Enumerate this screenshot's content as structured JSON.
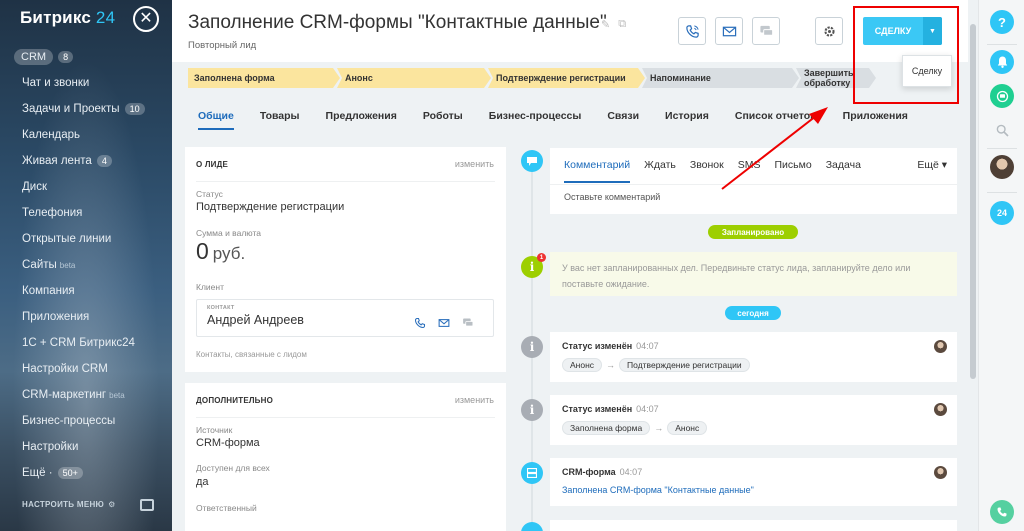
{
  "sidebar": {
    "logo_brand": "Битрикс",
    "logo_num": "24",
    "items": [
      {
        "label": "CRM",
        "badge": "8"
      },
      {
        "label": "Чат и звонки",
        "badge": ""
      },
      {
        "label": "Задачи и Проекты",
        "badge": "10"
      },
      {
        "label": "Календарь",
        "badge": ""
      },
      {
        "label": "Живая лента",
        "badge": "4"
      },
      {
        "label": "Диск",
        "badge": ""
      },
      {
        "label": "Телефония",
        "badge": ""
      },
      {
        "label": "Открытые линии",
        "badge": ""
      },
      {
        "label": "Сайты",
        "sup": "beta"
      },
      {
        "label": "Компания",
        "badge": ""
      },
      {
        "label": "Приложения",
        "badge": ""
      },
      {
        "label": "1С + CRM Битрикс24",
        "badge": ""
      },
      {
        "label": "Настройки CRM",
        "badge": ""
      },
      {
        "label": "CRM-маркетинг",
        "sup": "beta"
      },
      {
        "label": "Бизнес-процессы",
        "badge": ""
      },
      {
        "label": "Настройки",
        "badge": ""
      },
      {
        "label": "Ещё ·",
        "badge": "50+"
      }
    ],
    "footer": "НАСТРОИТЬ МЕНЮ"
  },
  "header": {
    "title": "Заполнение CRM-формы \"Контактные данные\"",
    "subtitle": "Повторный лид",
    "deal_button": "СДЕЛКУ",
    "deal_tooltip": "Сделку"
  },
  "stages": [
    {
      "label": "Заполнена форма",
      "state": "done"
    },
    {
      "label": "Анонс",
      "state": "done"
    },
    {
      "label": "Подтверждение регистрации",
      "state": "done"
    },
    {
      "label": "Напоминание",
      "state": "todo"
    },
    {
      "label": "Завершить обработку",
      "state": "todo"
    }
  ],
  "tabs": [
    "Общие",
    "Товары",
    "Предложения",
    "Роботы",
    "Бизнес-процессы",
    "Связи",
    "История",
    "Список отчетов",
    "Приложения"
  ],
  "about": {
    "header": "О ЛИДЕ",
    "edit": "изменить",
    "status_label": "Статус",
    "status_value": "Подтверждение регистрации",
    "amount_label": "Сумма и валюта",
    "amount_value": "0",
    "currency": "руб.",
    "client_label": "Клиент",
    "contact_kind": "КОНТАКТ",
    "contact_name": "Андрей Андреев",
    "related": "Контакты, связанные с лидом"
  },
  "extra": {
    "header": "ДОПОЛНИТЕЛЬНО",
    "edit": "изменить",
    "source_label": "Источник",
    "source_value": "CRM-форма",
    "avail_label": "Доступен для всех",
    "avail_value": "да",
    "resp_label": "Ответственный"
  },
  "composer": {
    "tabs": [
      "Комментарий",
      "Ждать",
      "Звонок",
      "SMS",
      "Письмо",
      "Задача"
    ],
    "more": "Ещё ▾",
    "placeholder": "Оставьте комментарий"
  },
  "timeline": {
    "planned_label": "Запланировано",
    "planned_badge": "1",
    "planned_text": "У вас нет запланированных дел. Передвиньте статус лида, запланируйте дело или поставьте ожидание.",
    "today_label": "сегодня",
    "events": [
      {
        "title": "Статус изменён",
        "time": "04:07",
        "from": "Анонс",
        "arrow": "→",
        "to": "Подтверждение регистрации"
      },
      {
        "title": "Статус изменён",
        "time": "04:07",
        "from": "Заполнена форма",
        "arrow": "→",
        "to": "Анонс"
      },
      {
        "title": "CRM-форма",
        "time": "04:07",
        "link": "Заполнена CRM-форма \"Контактные данные\""
      }
    ]
  },
  "rightbar": {
    "help": "?",
    "b24": "24"
  },
  "colors": {
    "accent": "#2fc6f6",
    "link": "#1e6cbb",
    "stage_done": "#fbe59e",
    "stage_todo": "#d9dee2",
    "green": "#9dcf00",
    "annotation": "#ee0000"
  }
}
